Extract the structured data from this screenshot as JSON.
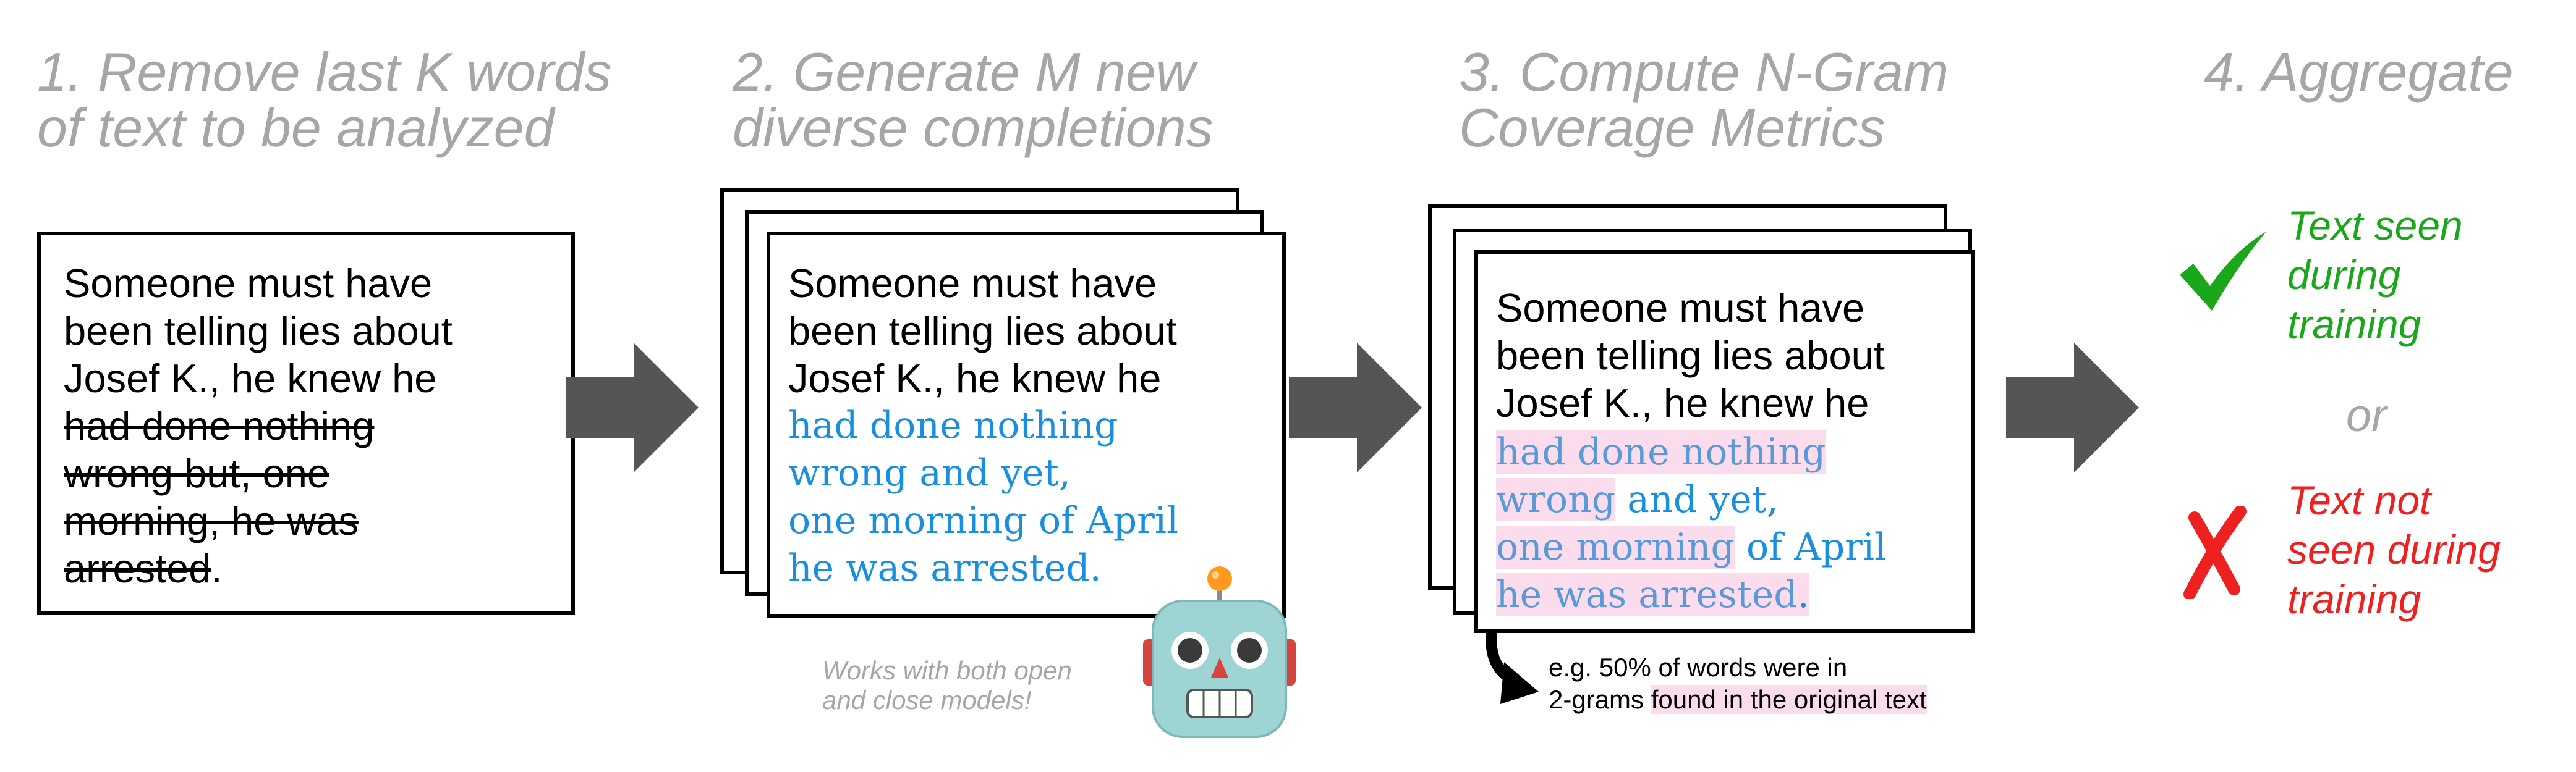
{
  "steps": [
    {
      "heading": [
        "1. Remove last K words",
        "of text to be analyzed"
      ]
    },
    {
      "heading": [
        "2. Generate M new",
        "diverse completions"
      ]
    },
    {
      "heading": [
        "3. Compute N-Gram",
        "Coverage Metrics"
      ]
    },
    {
      "heading": [
        "4. Aggregate"
      ]
    }
  ],
  "card1": {
    "kept": [
      "Someone must have",
      "been telling lies about",
      "Josef K., he knew he"
    ],
    "removed": [
      "had done nothing",
      "wrong but, one",
      "morning, he was",
      "arrested"
    ],
    "period": "."
  },
  "card2": {
    "kept": [
      "Someone must have",
      "been telling lies about",
      "Josef K., he knew he"
    ],
    "generated": [
      "had done nothing",
      "wrong and yet,",
      "one morning of April",
      "he was arrested."
    ]
  },
  "card3": {
    "kept": [
      "Someone must have",
      "been telling lies about",
      "Josef K., he knew he"
    ],
    "line4": {
      "hl": "had done nothing"
    },
    "line5": {
      "hl": "wrong",
      "rest": " and yet,"
    },
    "line6": {
      "hl": "one morning",
      "rest": " of April"
    },
    "line7": {
      "hl": "he was arrested",
      "rest": "."
    }
  },
  "note": [
    "Works with both open",
    "and close models!"
  ],
  "example": {
    "line1": "e.g. 50% of words were in",
    "line2_plain": "2-grams ",
    "line2_hl": "found in the original text"
  },
  "aggregate": {
    "seen": [
      "Text seen",
      "during",
      "training"
    ],
    "or": "or",
    "not_seen": [
      "Text not",
      "seen during",
      "training"
    ]
  },
  "colors": {
    "heading": "#a6a6a6",
    "generated": "#1a8fe0",
    "highlight": "#fbdcec",
    "arrow": "#555555",
    "seen": "#1aa71a",
    "not_seen": "#ee2020"
  }
}
